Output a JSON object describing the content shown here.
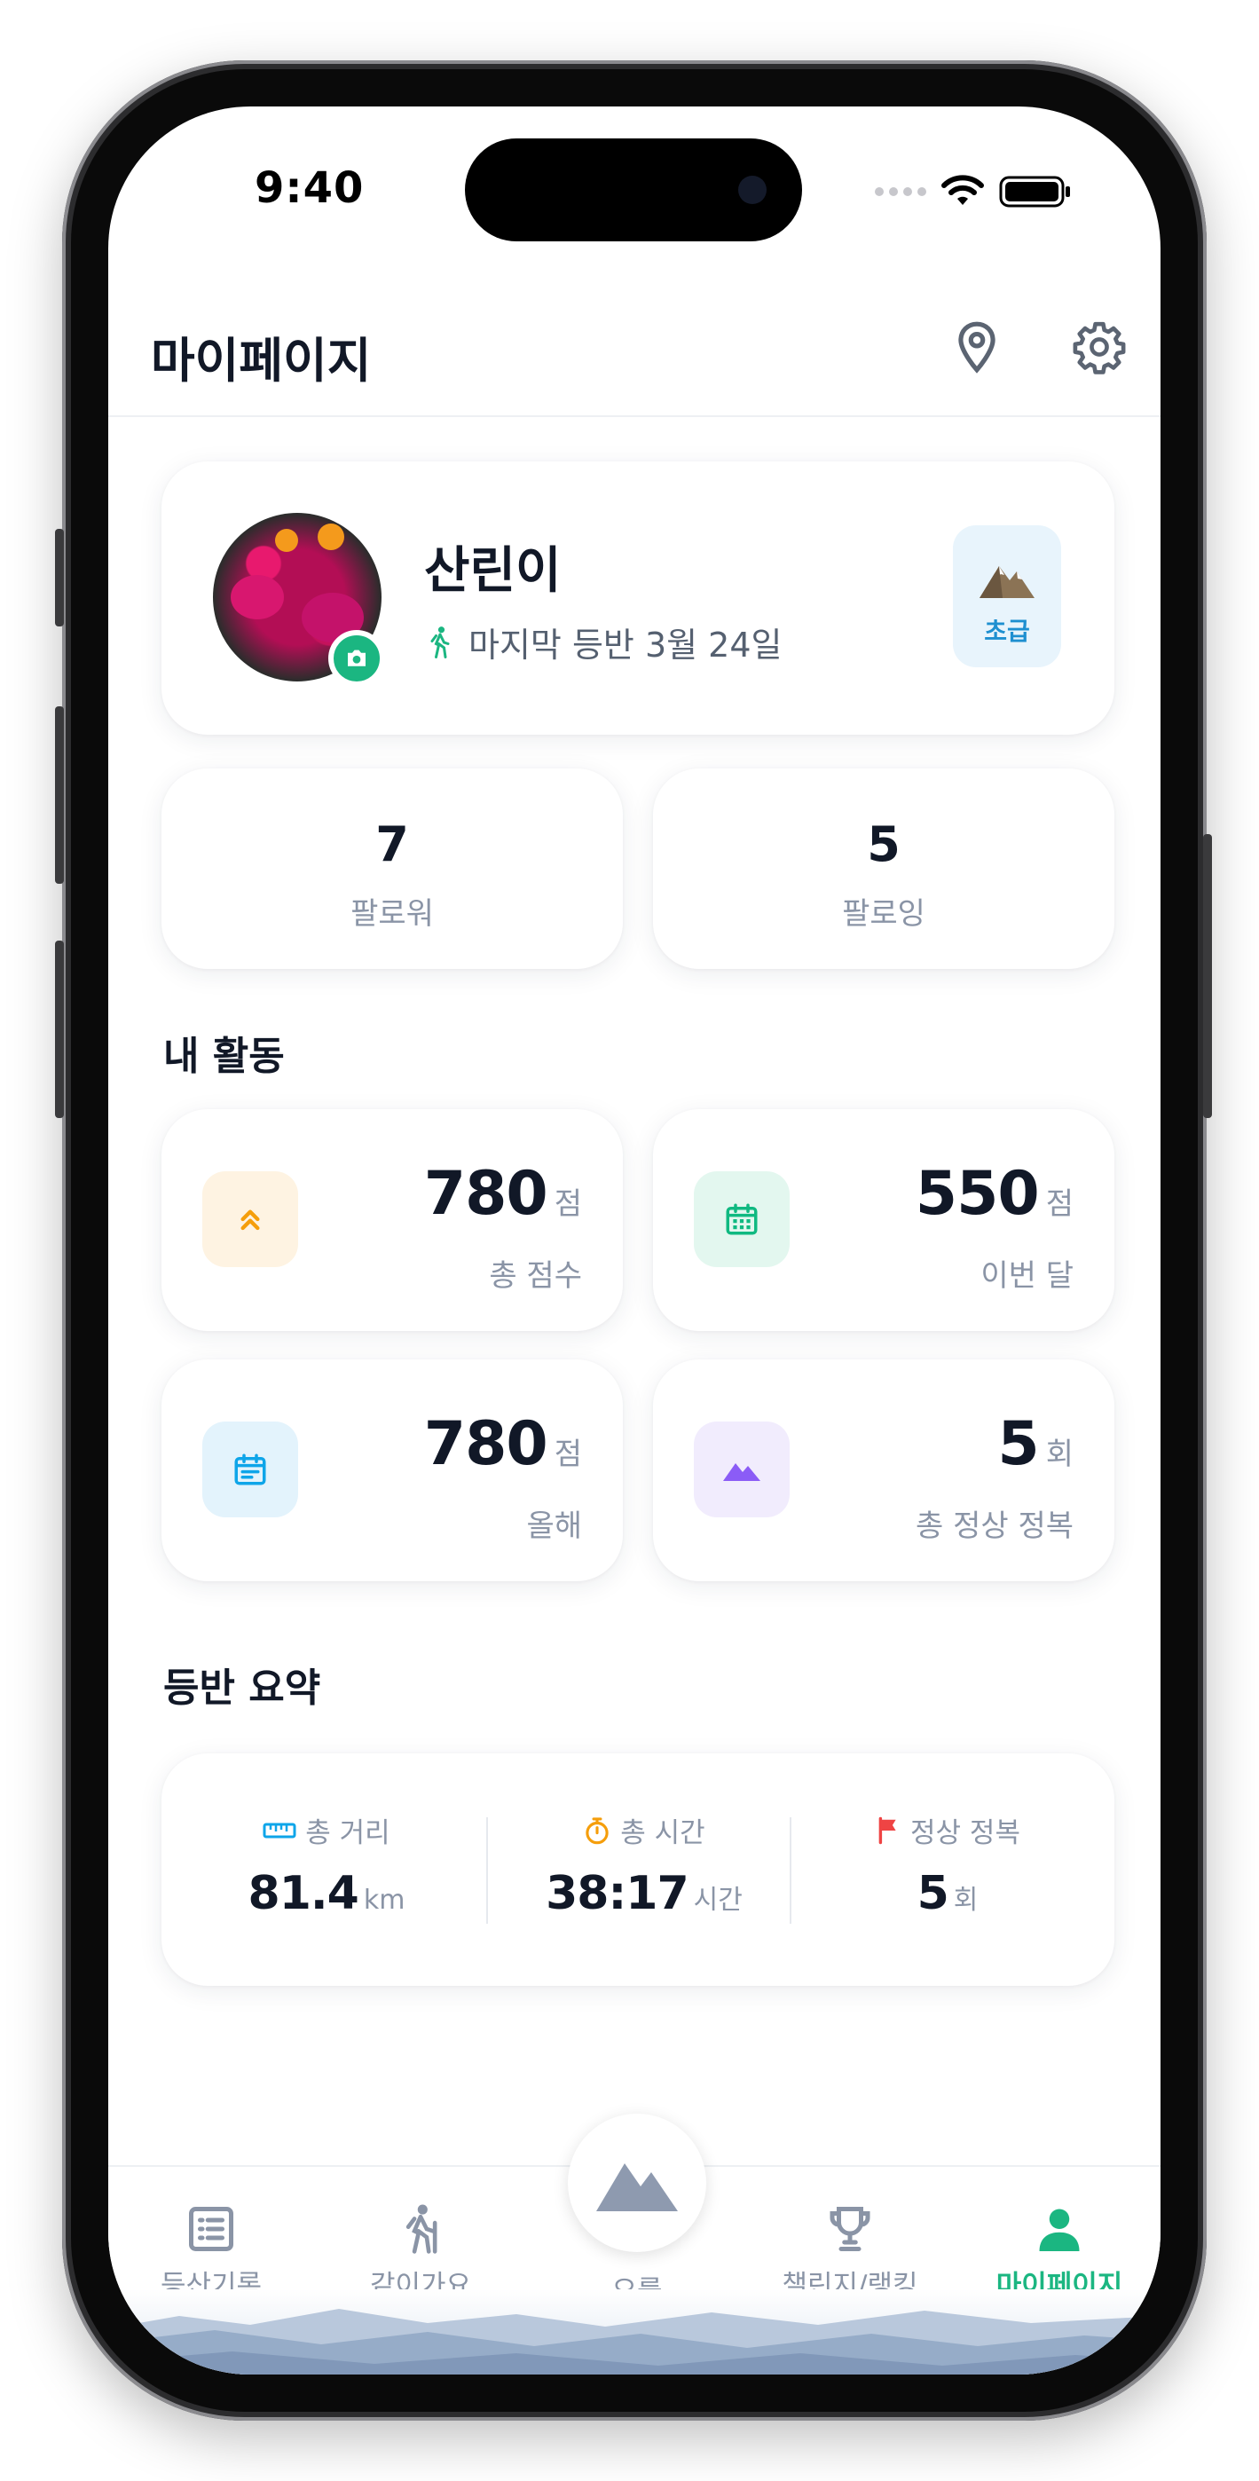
{
  "status_bar": {
    "time": "9:40"
  },
  "header": {
    "title": "마이페이지",
    "location_icon": "location-pin-icon",
    "settings_icon": "gear-icon"
  },
  "profile": {
    "name": "산린이",
    "last_climb": "마지막 등반 3월 24일",
    "level": "초급"
  },
  "follow": {
    "followers": {
      "value": "7",
      "label": "팔로워"
    },
    "following": {
      "value": "5",
      "label": "팔로잉"
    }
  },
  "activity": {
    "title": "내 활동",
    "stats": [
      {
        "value": "780",
        "unit": "점",
        "label": "총 점수",
        "icon": "double-chevron-up-icon",
        "color": "#f59e0b"
      },
      {
        "value": "550",
        "unit": "점",
        "label": "이번 달",
        "icon": "calendar-icon",
        "color": "#10b981"
      },
      {
        "value": "780",
        "unit": "점",
        "label": "올해",
        "icon": "calendar-list-icon",
        "color": "#0ea5e9"
      },
      {
        "value": "5",
        "unit": "회",
        "label": "총 정상 정복",
        "icon": "mountain-icon",
        "color": "#8b5cf6"
      }
    ]
  },
  "summary": {
    "title": "등반 요약",
    "items": [
      {
        "label": "총 거리",
        "value": "81.4",
        "unit": "km",
        "icon": "ruler-icon"
      },
      {
        "label": "총 시간",
        "value": "38:17",
        "unit": "시간",
        "icon": "stopwatch-icon"
      },
      {
        "label": "정상 정복",
        "value": "5",
        "unit": "회",
        "icon": "flag-icon"
      }
    ]
  },
  "tabs": [
    {
      "label": "등산기록",
      "icon": "list-icon"
    },
    {
      "label": "같이가요",
      "icon": "hiker-icon"
    },
    {
      "label": "오를",
      "icon": "mountain-icon"
    },
    {
      "label": "챌린지/랭킹",
      "icon": "trophy-icon"
    },
    {
      "label": "마이페이지",
      "icon": "person-icon",
      "active": true
    }
  ],
  "colors": {
    "accent": "#1bb681",
    "text": "#111827",
    "muted": "#8a94a6"
  }
}
